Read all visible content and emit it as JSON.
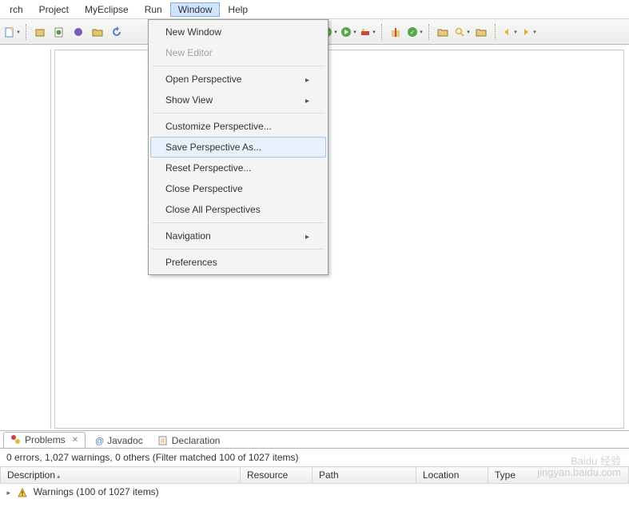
{
  "menubar": {
    "items": [
      {
        "label": "rch"
      },
      {
        "label": "Project"
      },
      {
        "label": "MyEclipse"
      },
      {
        "label": "Run"
      },
      {
        "label": "Window",
        "active": true
      },
      {
        "label": "Help"
      }
    ]
  },
  "dropdown": {
    "groups": [
      [
        {
          "label": "New Window",
          "enabled": true
        },
        {
          "label": "New Editor",
          "enabled": false
        }
      ],
      [
        {
          "label": "Open Perspective",
          "submenu": true
        },
        {
          "label": "Show View",
          "submenu": true
        }
      ],
      [
        {
          "label": "Customize Perspective..."
        },
        {
          "label": "Save Perspective As...",
          "highlight": true
        },
        {
          "label": "Reset Perspective..."
        },
        {
          "label": "Close Perspective"
        },
        {
          "label": "Close All Perspectives"
        }
      ],
      [
        {
          "label": "Navigation",
          "submenu": true
        }
      ],
      [
        {
          "label": "Preferences"
        }
      ]
    ]
  },
  "bottom": {
    "tabs": [
      {
        "label": "Problems",
        "active": true,
        "icon": "problems"
      },
      {
        "label": "Javadoc",
        "icon": "javadoc"
      },
      {
        "label": "Declaration",
        "icon": "declaration"
      }
    ],
    "status": "0 errors, 1,027 warnings, 0 others (Filter matched 100 of 1027 items)",
    "columns": [
      "Description",
      "Resource",
      "Path",
      "Location",
      "Type"
    ],
    "rows": [
      {
        "text": "Warnings (100 of 1027 items)",
        "icon": "warning"
      }
    ]
  },
  "watermark": {
    "line1": "Baidu 经验",
    "line2": "jingyan.baidu.com"
  }
}
